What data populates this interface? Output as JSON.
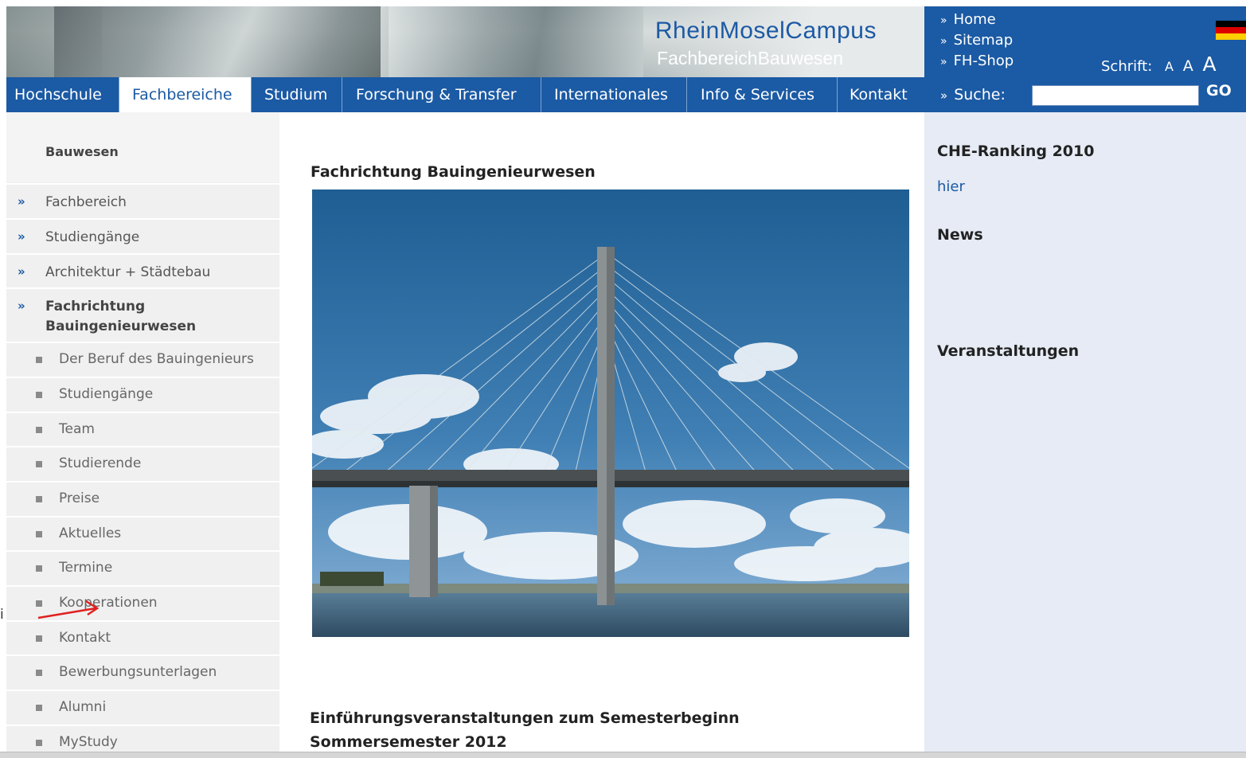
{
  "header": {
    "title": "RheinMoselCampus",
    "subtitle": "FachbereichBauwesen",
    "top_links": [
      "Home",
      "Sitemap",
      "FH-Shop"
    ],
    "font_size_label": "Schrift:",
    "font_sizes": [
      "A",
      "A",
      "A"
    ],
    "flag_colors": [
      "#000000",
      "#dd0000",
      "#ffce00"
    ]
  },
  "nav": {
    "tabs": [
      "Hochschule",
      "Fachbereiche",
      "Studium",
      "Forschung & Transfer",
      "Internationales",
      "Info & Services",
      "Kontakt"
    ],
    "active_tab": "Fachbereiche"
  },
  "search": {
    "label": "Suche:",
    "value": "",
    "button": "GO"
  },
  "sidebar": {
    "heading": "Bauwesen",
    "items": [
      "Fachbereich",
      "Studiengänge",
      "Architektur + Städtebau"
    ],
    "active_item": [
      "Fachrichtung",
      "Bauingenieurwesen"
    ],
    "sub_items": [
      "Der Beruf des Bauingenieurs",
      "Studiengänge",
      "Team",
      "Studierende",
      "Preise",
      "Aktuelles",
      "Termine",
      "Kooperationen",
      "Kontakt",
      "Bewerbungsunterlagen",
      "Alumni",
      "MyStudy"
    ]
  },
  "main": {
    "title": "Fachrichtung Bauingenieurwesen",
    "subtitle_line1": "Einführungsveranstaltungen zum Semesterbeginn",
    "subtitle_line2": "Sommersemester 2012"
  },
  "rightcol": {
    "che_heading": "CHE-Ranking 2010",
    "che_link": "hier",
    "news_heading": "News",
    "events_heading": "Veranstaltungen"
  },
  "annotation": {
    "stray_char": "i",
    "arrow_color": "#e02020"
  }
}
